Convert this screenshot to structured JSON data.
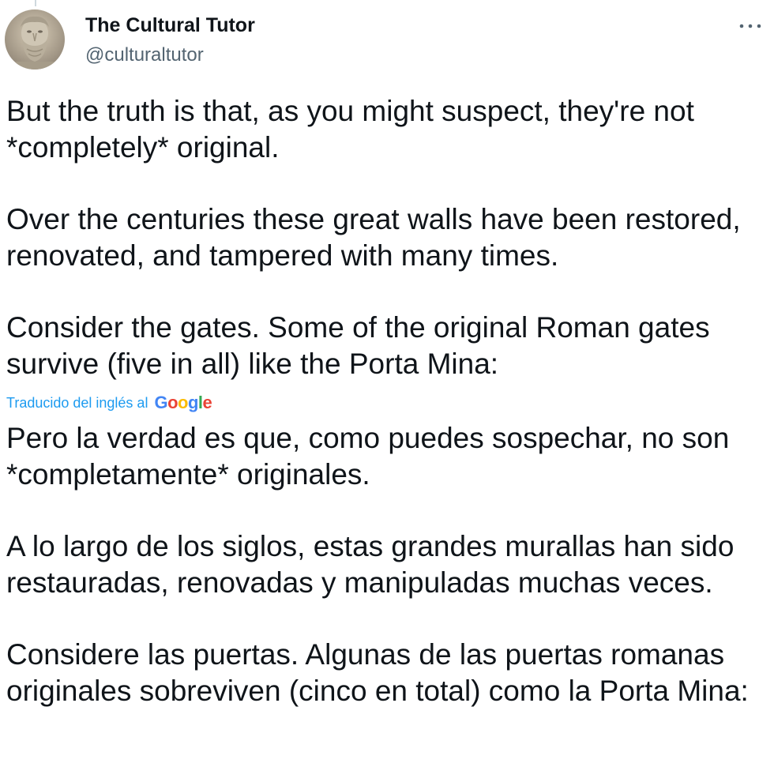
{
  "author": {
    "display_name": "The Cultural Tutor",
    "handle": "@culturaltutor",
    "avatar_icon": "classical-bust-avatar"
  },
  "more_menu_icon": "ellipsis-icon",
  "tweet": {
    "paragraphs": [
      "But the truth is that, as you might suspect, they're not *completely* original.",
      "Over the centuries these great walls have been restored, renovated, and tampered with many times.",
      "Consider the gates. Some of the original Roman gates survive (five in all) like the Porta Mina:"
    ]
  },
  "translation": {
    "label": "Traducido del inglés al",
    "provider_letters": [
      "G",
      "o",
      "o",
      "g",
      "l",
      "e"
    ],
    "paragraphs": [
      "Pero la verdad es que, como puedes sospechar, no son *completamente* originales.",
      "A lo largo de los siglos, estas grandes murallas han sido restauradas, renovadas y manipuladas muchas veces.",
      "Considere las puertas. Algunas de las puertas romanas originales sobreviven (cinco en total) como la Porta Mina:"
    ]
  },
  "colors": {
    "text": "#0f1419",
    "secondary": "#536471",
    "link": "#1d9bf0",
    "google_blue": "#4285f4",
    "google_red": "#ea4335",
    "google_yellow": "#fbbc05",
    "google_green": "#34a853"
  }
}
